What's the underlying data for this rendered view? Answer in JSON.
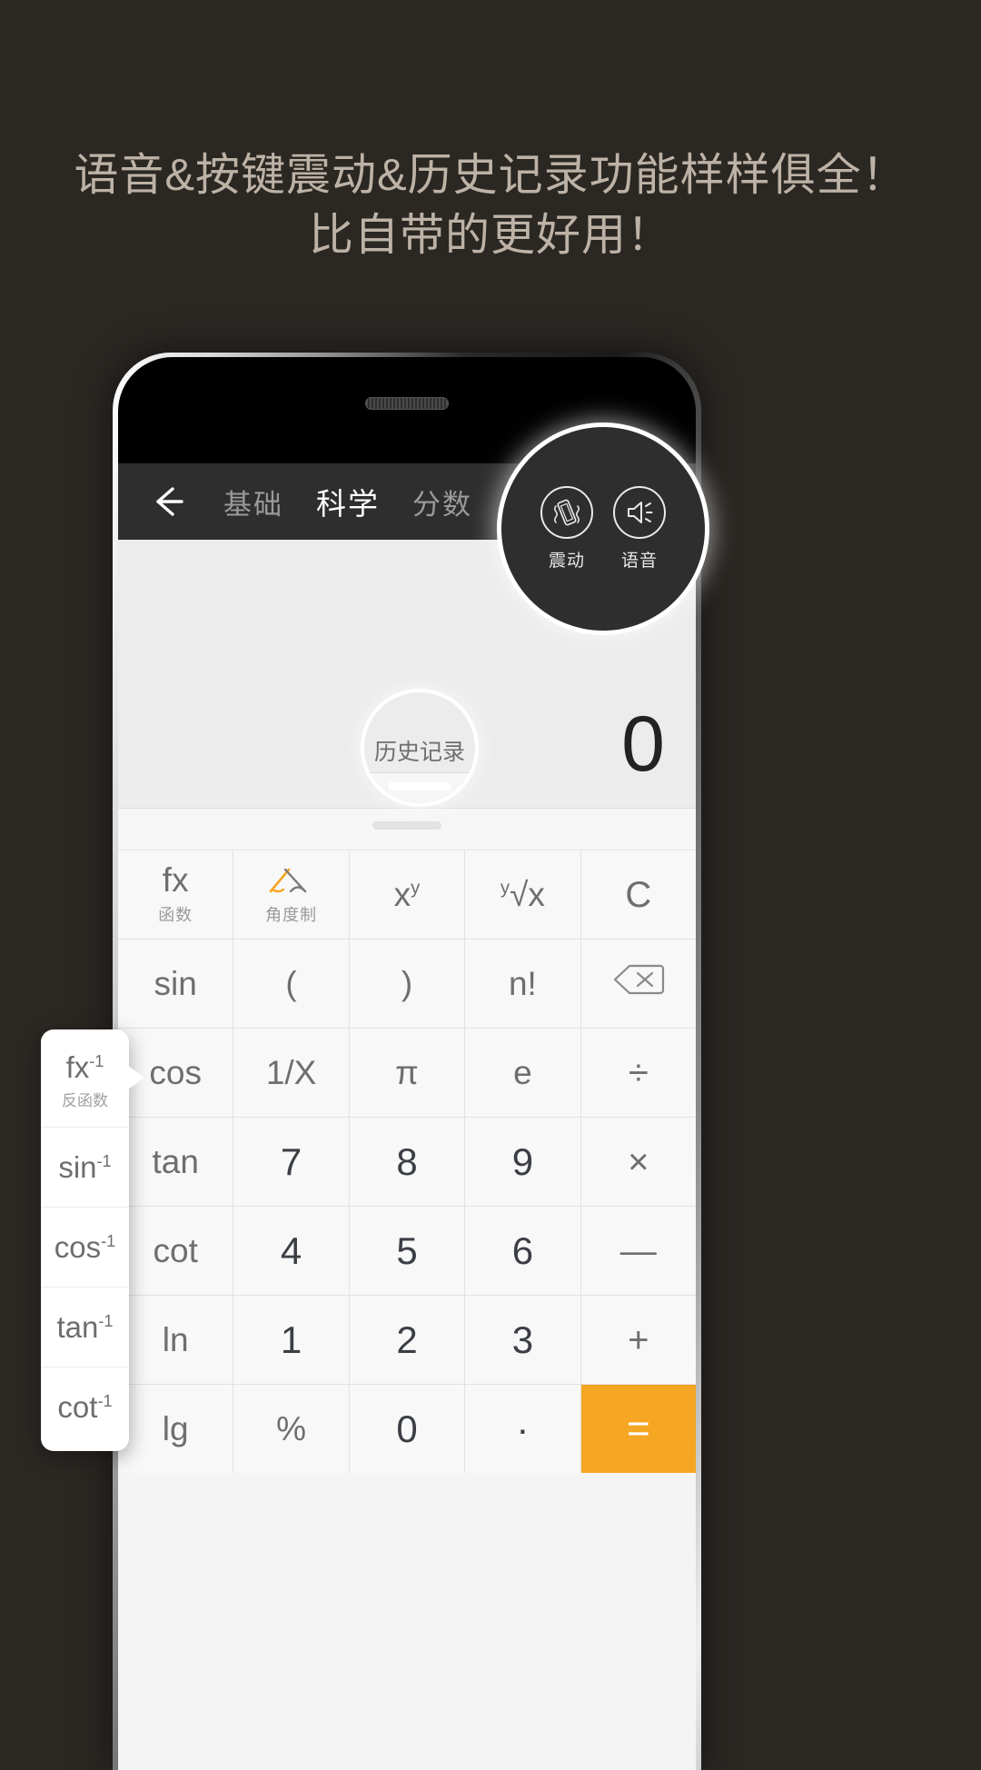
{
  "headline": {
    "line1": "语音&按键震动&历史记录功能样样俱全！",
    "line2": "比自带的更好用！"
  },
  "colors": {
    "background": "#2b2723",
    "headline_text": "#bdb2a6",
    "navbar": "#2e2e2e",
    "accent_orange": "#f5a623",
    "key_face": "#f8f8f8",
    "display": "#ececec"
  },
  "app": {
    "navbar": {
      "back_icon": "back-arrow-icon",
      "tabs": [
        {
          "label": "基础",
          "active": false
        },
        {
          "label": "科学",
          "active": true
        },
        {
          "label": "分数",
          "active": false
        }
      ]
    },
    "toolbar_spotlight": {
      "tools": [
        {
          "icon": "vibrate-icon",
          "label": "震动"
        },
        {
          "icon": "speaker-icon",
          "label": "语音"
        }
      ]
    },
    "display": {
      "result": "0"
    },
    "history_spotlight": {
      "label": "历史记录",
      "handle": "drag-handle"
    },
    "keypad": {
      "rows": [
        [
          {
            "main": "fx",
            "sub": "函数",
            "type": "func"
          },
          {
            "main": "",
            "sub": "角度制",
            "type": "angle-icon"
          },
          {
            "main": "x",
            "sup": "y",
            "type": "func"
          },
          {
            "main": "√x",
            "pre": "y",
            "type": "func"
          },
          {
            "main": "C",
            "type": "op"
          }
        ],
        [
          {
            "main": "sin",
            "type": "func"
          },
          {
            "main": "(",
            "type": "func"
          },
          {
            "main": ")",
            "type": "func"
          },
          {
            "main": "n!",
            "type": "func"
          },
          {
            "main": "backspace-icon",
            "type": "icon"
          }
        ],
        [
          {
            "main": "cos",
            "type": "func"
          },
          {
            "main": "1/X",
            "type": "func"
          },
          {
            "main": "π",
            "type": "func"
          },
          {
            "main": "e",
            "type": "func"
          },
          {
            "main": "÷",
            "type": "op"
          }
        ],
        [
          {
            "main": "tan",
            "type": "func"
          },
          {
            "main": "7",
            "type": "num"
          },
          {
            "main": "8",
            "type": "num"
          },
          {
            "main": "9",
            "type": "num"
          },
          {
            "main": "×",
            "type": "op"
          }
        ],
        [
          {
            "main": "cot",
            "type": "func"
          },
          {
            "main": "4",
            "type": "num"
          },
          {
            "main": "5",
            "type": "num"
          },
          {
            "main": "6",
            "type": "num"
          },
          {
            "main": "—",
            "type": "op"
          }
        ],
        [
          {
            "main": "ln",
            "type": "func"
          },
          {
            "main": "1",
            "type": "num"
          },
          {
            "main": "2",
            "type": "num"
          },
          {
            "main": "3",
            "type": "num"
          },
          {
            "main": "+",
            "type": "op"
          }
        ],
        [
          {
            "main": "lg",
            "type": "func"
          },
          {
            "main": "%",
            "type": "func"
          },
          {
            "main": "0",
            "type": "num"
          },
          {
            "main": "·",
            "type": "num"
          },
          {
            "main": "=",
            "type": "equals"
          }
        ]
      ]
    },
    "inverse_panel": {
      "items": [
        {
          "main": "fx",
          "sup": "-1",
          "sub": "反函数"
        },
        {
          "main": "sin",
          "sup": "-1"
        },
        {
          "main": "cos",
          "sup": "-1"
        },
        {
          "main": "tan",
          "sup": "-1"
        },
        {
          "main": "cot",
          "sup": "-1"
        }
      ]
    }
  }
}
